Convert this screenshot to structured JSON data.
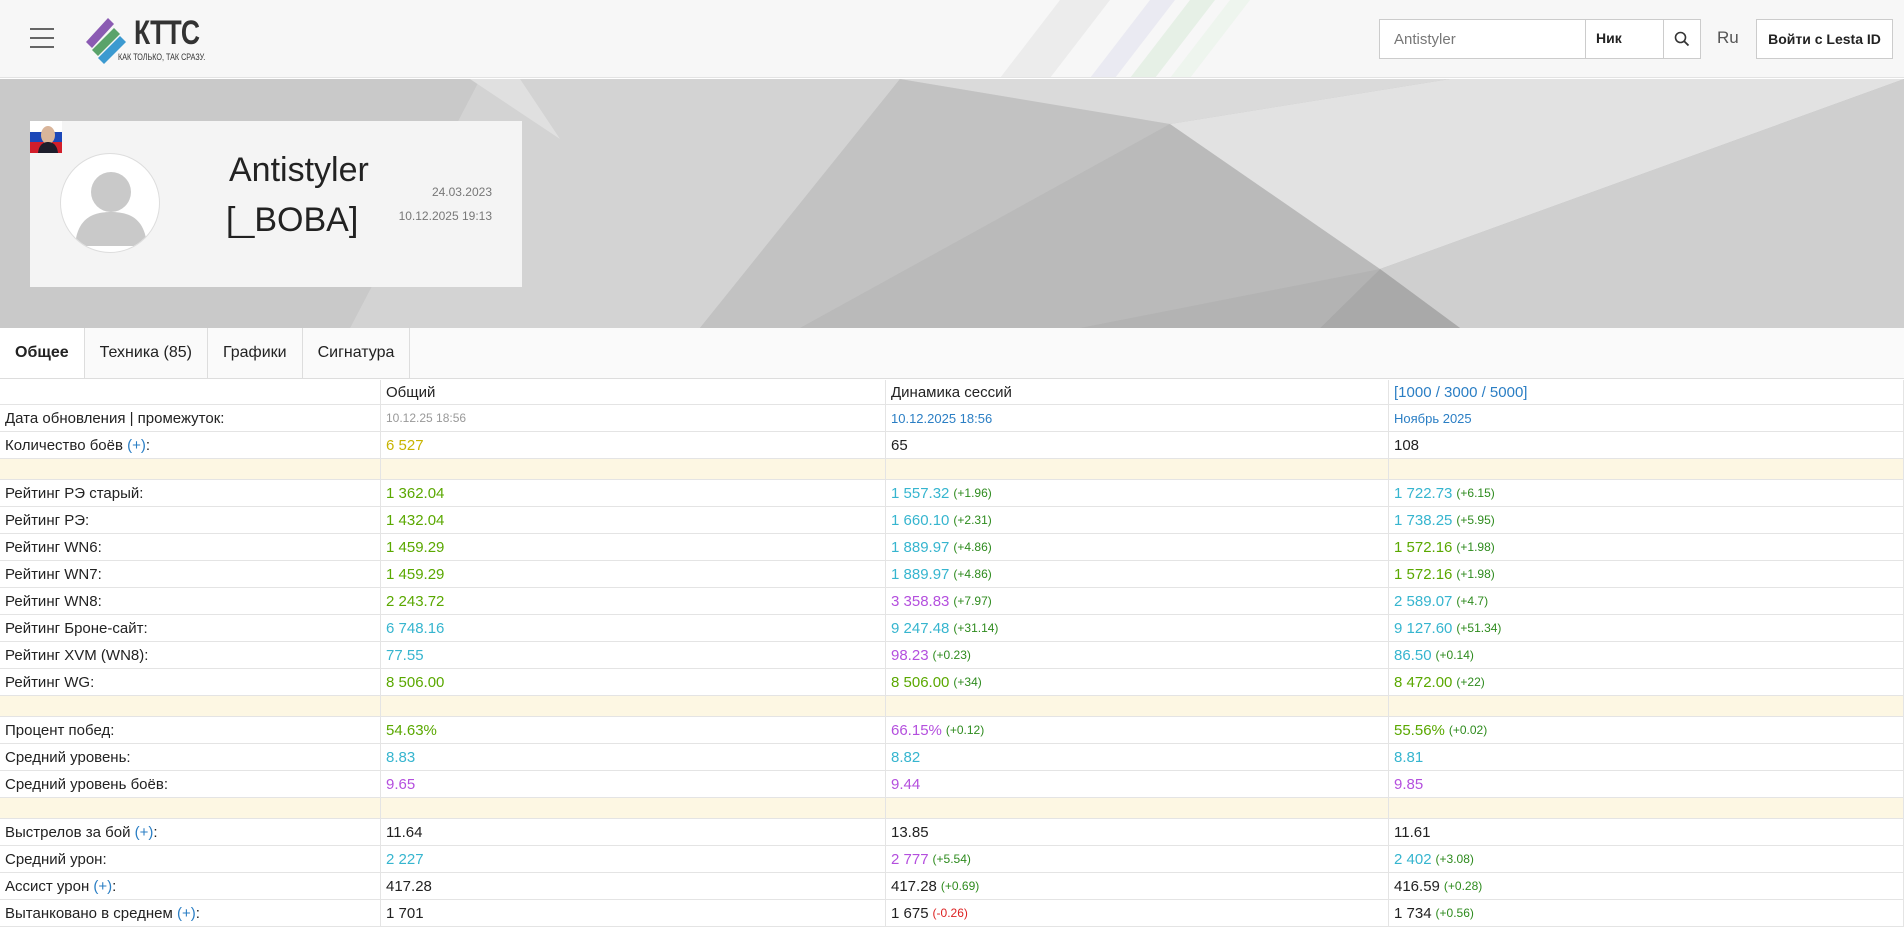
{
  "colors": {
    "green": "#5aa800",
    "cyan": "#36b5cf",
    "purple": "#b44fde",
    "olive": "#c8b400",
    "dark": "#222222",
    "delta_pos": "#2e8b1e",
    "delta_neg": "#dd2222",
    "link": "#2a7ec4"
  },
  "header": {
    "logo_text": "КТТС",
    "logo_sub": "КАК ТОЛЬКО, ТАК СРАЗУ.",
    "search_placeholder": "Antistyler",
    "search_type": "Ник",
    "lang": "Ru",
    "login_label": "Войти с Lesta ID"
  },
  "profile": {
    "name": "Antistyler",
    "clan": "[_BOBA]",
    "date_registered": "24.03.2023",
    "date_last": "10.12.2025 19:13"
  },
  "tabs": [
    {
      "label": "Общее",
      "active": true
    },
    {
      "label": "Техника (85)",
      "active": false
    },
    {
      "label": "Графики",
      "active": false
    },
    {
      "label": "Сигнатура",
      "active": false
    }
  ],
  "table": {
    "headers": [
      "",
      "Общий",
      "Динамика сессий",
      "[1000 / 3000 / 5000]"
    ],
    "update_row": {
      "label": "Дата обновления | промежуток:",
      "c1": "10.12.25 18:56",
      "c2": "10.12.2025 18:56",
      "c3": "Ноябрь 2025"
    },
    "battles_row": {
      "label": "Количество боёв",
      "plus": "(+)",
      "colon": ":",
      "c1": "6 527",
      "c2": "65",
      "c3": "108"
    },
    "rows_a": [
      {
        "label": "Рейтинг РЭ старый:",
        "v1": "1 362.04",
        "k1": "green",
        "v2": "1 557.32",
        "k2": "cyan",
        "d2": "(+1.96)",
        "v3": "1 722.73",
        "k3": "cyan",
        "d3": "(+6.15)"
      },
      {
        "label": "Рейтинг РЭ:",
        "v1": "1 432.04",
        "k1": "green",
        "v2": "1 660.10",
        "k2": "cyan",
        "d2": "(+2.31)",
        "v3": "1 738.25",
        "k3": "cyan",
        "d3": "(+5.95)"
      },
      {
        "label": "Рейтинг WN6:",
        "v1": "1 459.29",
        "k1": "green",
        "v2": "1 889.97",
        "k2": "cyan",
        "d2": "(+4.86)",
        "v3": "1 572.16",
        "k3": "green",
        "d3": "(+1.98)"
      },
      {
        "label": "Рейтинг WN7:",
        "v1": "1 459.29",
        "k1": "green",
        "v2": "1 889.97",
        "k2": "cyan",
        "d2": "(+4.86)",
        "v3": "1 572.16",
        "k3": "green",
        "d3": "(+1.98)"
      },
      {
        "label": "Рейтинг WN8:",
        "v1": "2 243.72",
        "k1": "green",
        "v2": "3 358.83",
        "k2": "purple",
        "d2": "(+7.97)",
        "v3": "2 589.07",
        "k3": "cyan",
        "d3": "(+4.7)"
      },
      {
        "label": "Рейтинг Броне-сайт:",
        "v1": "6 748.16",
        "k1": "cyan",
        "v2": "9 247.48",
        "k2": "cyan",
        "d2": "(+31.14)",
        "v3": "9 127.60",
        "k3": "cyan",
        "d3": "(+51.34)"
      },
      {
        "label": "Рейтинг XVM (WN8):",
        "v1": "77.55",
        "k1": "cyan",
        "v2": "98.23",
        "k2": "purple",
        "d2": "(+0.23)",
        "v3": "86.50",
        "k3": "cyan",
        "d3": "(+0.14)"
      },
      {
        "label": "Рейтинг WG:",
        "v1": "8 506.00",
        "k1": "green",
        "v2": "8 506.00",
        "k2": "green",
        "d2": "(+34)",
        "v3": "8 472.00",
        "k3": "green",
        "d3": "(+22)"
      }
    ],
    "rows_b": [
      {
        "label": "Процент побед:",
        "v1": "54.63%",
        "k1": "green",
        "v2": "66.15%",
        "k2": "purple",
        "d2": "(+0.12)",
        "v3": "55.56%",
        "k3": "green",
        "d3": "(+0.02)"
      },
      {
        "label": "Средний уровень:",
        "v1": "8.83",
        "k1": "cyan",
        "v2": "8.82",
        "k2": "cyan",
        "d2": "",
        "v3": "8.81",
        "k3": "cyan",
        "d3": ""
      },
      {
        "label": "Средний уровень боёв:",
        "v1": "9.65",
        "k1": "purple",
        "v2": "9.44",
        "k2": "purple",
        "d2": "",
        "v3": "9.85",
        "k3": "purple",
        "d3": ""
      }
    ],
    "rows_c": [
      {
        "label": "Выстрелов за бой",
        "plus": "(+)",
        "v1": "11.64",
        "k1": "dark",
        "v2": "13.85",
        "k2": "dark",
        "d2": "",
        "v3": "11.61",
        "k3": "dark",
        "d3": ""
      },
      {
        "label": "Средний урон:",
        "plus": "",
        "v1": "2 227",
        "k1": "cyan",
        "v2": "2 777",
        "k2": "purple",
        "d2": "(+5.54)",
        "v3": "2 402",
        "k3": "cyan",
        "d3": "(+3.08)"
      },
      {
        "label": "Ассист урон",
        "plus": "(+)",
        "v1": "417.28",
        "k1": "dark",
        "v2": "417.28",
        "k2": "dark",
        "d2": "(+0.69)",
        "v3": "416.59",
        "k3": "dark",
        "d3": "(+0.28)"
      },
      {
        "label": "Вытанковано в среднем",
        "plus": "(+)",
        "v1": "1 701",
        "k1": "dark",
        "v2": "1 675",
        "k2": "dark",
        "d2": "(-0.26)",
        "v3": "1 734",
        "k3": "dark",
        "d3": "(+0.56)"
      }
    ]
  }
}
